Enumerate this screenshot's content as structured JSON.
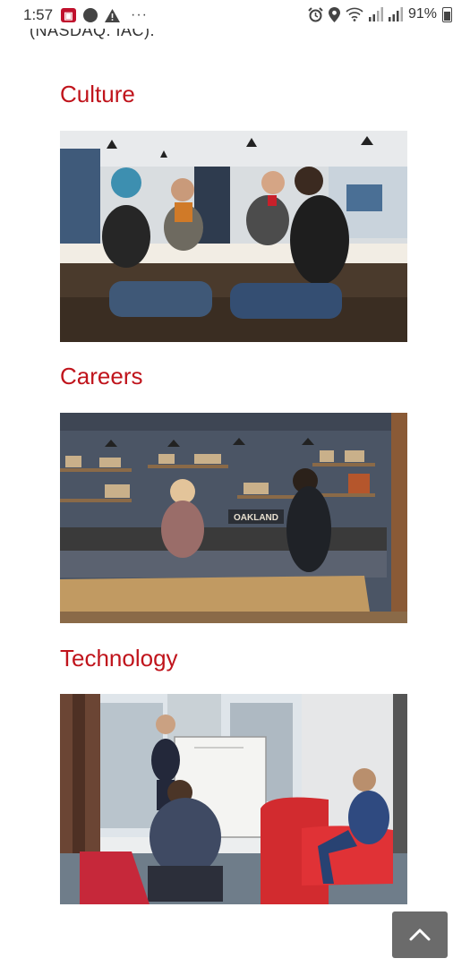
{
  "status_bar": {
    "time": "1:57",
    "more": "···",
    "battery": "91%"
  },
  "intro_fragment": "(NASDAQ: IAC).",
  "sections": [
    {
      "title": "Culture",
      "image": "office-team-chatting-at-bar-table"
    },
    {
      "title": "Careers",
      "image": "coffee-break-in-office-kitchen"
    },
    {
      "title": "Technology",
      "image": "team-meeting-at-whiteboard"
    }
  ],
  "photo_signs": {
    "careers_sign": "OAKLAND"
  },
  "colors": {
    "section_title": "#c0141c",
    "back_to_top_bg": "#6b6b6b"
  },
  "back_to_top_icon": "chevron-up-icon"
}
